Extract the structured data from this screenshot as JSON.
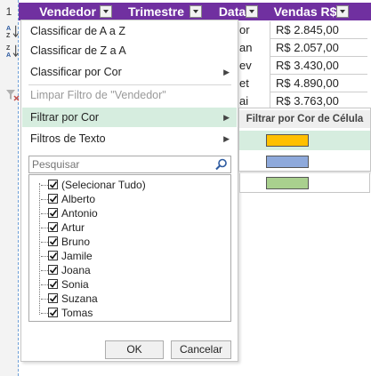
{
  "sheet": {
    "row_number": "1",
    "headers": [
      "Vendedor",
      "Trimestre",
      "Data",
      "Vendas R$"
    ],
    "header_color": "#7030a0",
    "partial_col": [
      "or",
      "an",
      "ev",
      "et",
      "ai"
    ],
    "sales": [
      "R$ 2.845,00",
      "R$ 2.057,00",
      "R$ 3.430,00",
      "R$ 4.890,00",
      "R$ 3.763,00"
    ]
  },
  "menu": {
    "sort_az": "Classificar de A a Z",
    "sort_za": "Classificar de Z a A",
    "sort_by_color": "Classificar por Cor",
    "clear_filter": "Limpar Filtro de \"Vendedor\"",
    "filter_by_color": "Filtrar por Cor",
    "text_filters": "Filtros de Texto",
    "search_placeholder": "Pesquisar",
    "items": [
      "(Selecionar Tudo)",
      "Alberto",
      "Antonio",
      "Artur",
      "Bruno",
      "Jamile",
      "Joana",
      "Sonia",
      "Suzana",
      "Tomas"
    ],
    "ok": "OK",
    "cancel": "Cancelar"
  },
  "submenu": {
    "title": "Filtrar por Cor de Célula",
    "colors": [
      "#ffc000",
      "#8ea9db",
      "#a9d08e"
    ]
  },
  "highlight_color": "#d6eddf"
}
